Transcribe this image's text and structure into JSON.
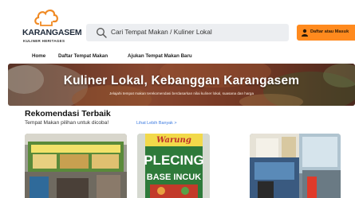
{
  "brand": {
    "name": "KARANGASEM",
    "tagline": "KULINER HERITAGES"
  },
  "search": {
    "placeholder": "Cari Tempat Makan / Kuliner Lokal"
  },
  "login_button": {
    "label": "Daftar atau Masuk"
  },
  "nav": {
    "items": [
      {
        "label": "Home"
      },
      {
        "label": "Daftar Tempat Makan"
      },
      {
        "label": "Ajukan Tempat Makan Baru"
      }
    ]
  },
  "banner": {
    "title": "Kuliner Lokal, Kebanggan Karangasem",
    "subtitle": "Jelajahi tempat makan terekomendasi berdasarkan nilai kuliner lokal, suasana dan harga"
  },
  "recommendations": {
    "title": "Rekomendasi Terbaik",
    "subtitle": "Tempat Makan pilihan untuk dicoba!",
    "see_more": "Lihat Lebih Banyak >",
    "cards": [
      {
        "sign_text": ""
      },
      {
        "sign_text": "PLECING\nBASE INCUK",
        "sign_top": "Warung"
      },
      {
        "sign_text": ""
      }
    ]
  },
  "colors": {
    "accent": "#ff8a1e",
    "link": "#3d7be0",
    "search_bg": "#eceef1",
    "logo_orange": "#f08a24"
  },
  "icons": [
    "cloud-chef-logo-icon",
    "search-icon",
    "user-icon"
  ]
}
